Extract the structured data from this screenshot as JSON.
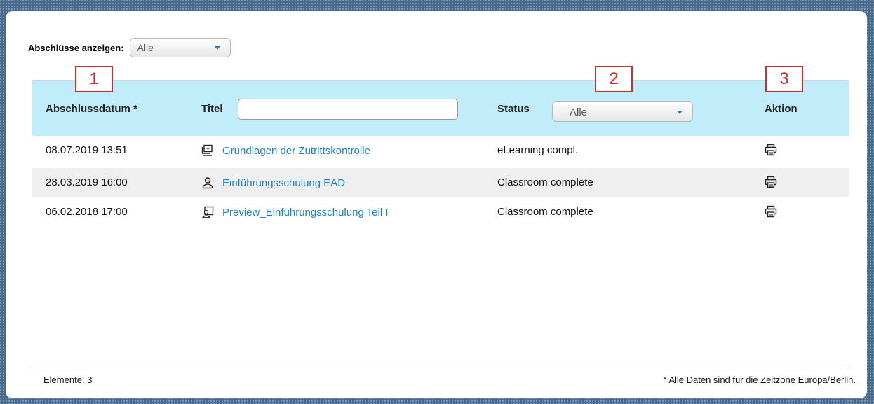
{
  "filter": {
    "label": "Abschlüsse anzeigen:",
    "value": "Alle"
  },
  "table": {
    "headers": {
      "date": "Abschlussdatum *",
      "title": "Titel",
      "status": "Status",
      "action": "Aktion"
    },
    "title_filter_value": "",
    "status_filter_value": "Alle",
    "rows": [
      {
        "date": "08.07.2019 13:51",
        "title": "Grundlagen der Zutrittskontrolle",
        "title_icon": "elearning-icon",
        "status": "eLearning compl.",
        "action_icon": "print-icon"
      },
      {
        "date": "28.03.2019 16:00",
        "title": "Einführungsschulung EAD",
        "title_icon": "person-icon",
        "status": "Classroom complete",
        "action_icon": "print-icon"
      },
      {
        "date": "06.02.2018 17:00",
        "title": "Preview_Einführungsschulung Teil I",
        "title_icon": "person-screen-icon",
        "status": "Classroom complete",
        "action_icon": "print-icon"
      }
    ]
  },
  "markers": [
    "1",
    "2",
    "3"
  ],
  "footer": {
    "count": "Elemente: 3",
    "timezone_note": "* Alle Daten sind für die Zeitzone Europa/Berlin."
  },
  "colors": {
    "header_bg": "#c1ecfa",
    "link": "#1f7fc6",
    "marker": "#d32a2a",
    "alt_row": "#efefef"
  }
}
